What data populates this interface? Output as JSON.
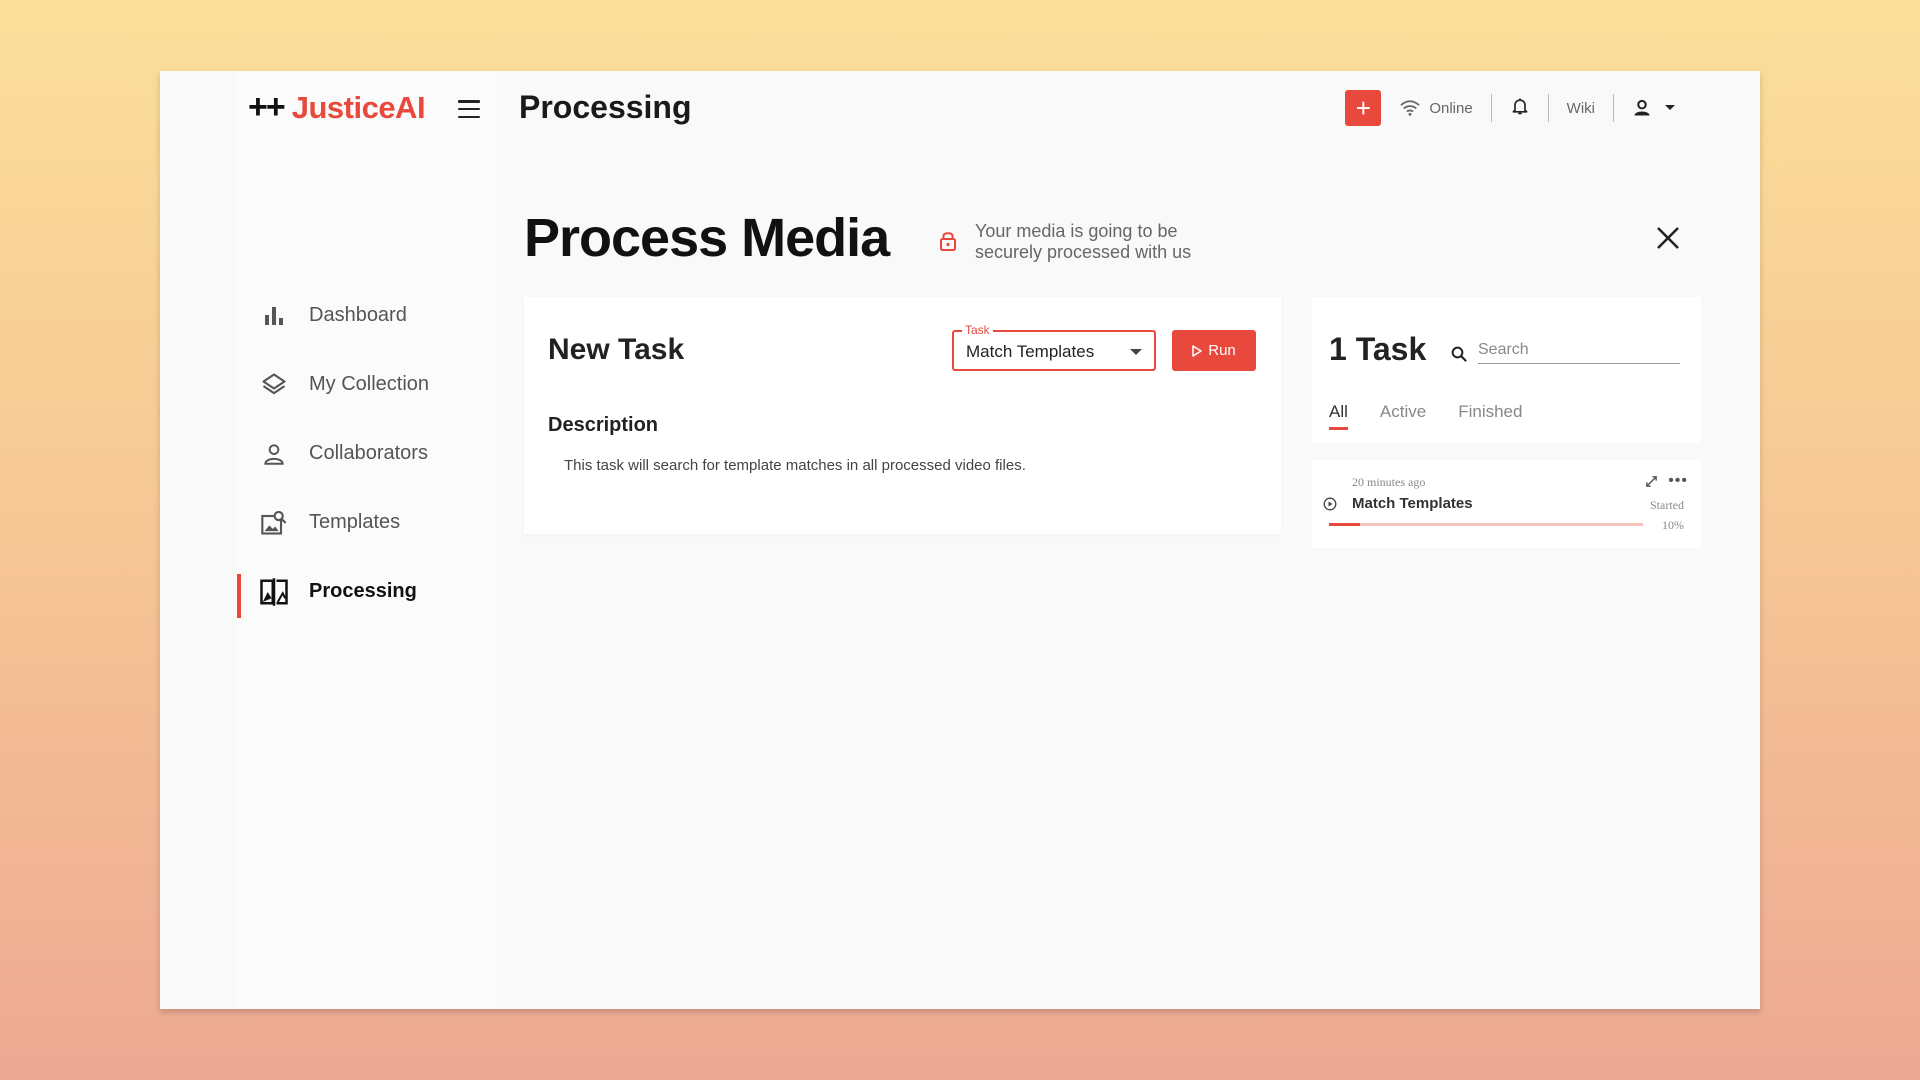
{
  "app": {
    "brand_symbol": "++",
    "brand_name": "JusticeAI",
    "page_title": "Processing",
    "accent_color": "#e8493c"
  },
  "header": {
    "add_icon": "plus-icon",
    "status_label": "Online",
    "wiki_label": "Wiki"
  },
  "sidebar": {
    "items": [
      {
        "label": "Dashboard",
        "icon": "bar-chart-icon"
      },
      {
        "label": "My Collection",
        "icon": "layers-icon"
      },
      {
        "label": "Collaborators",
        "icon": "person-icon"
      },
      {
        "label": "Templates",
        "icon": "image-search-icon"
      },
      {
        "label": "Processing",
        "icon": "compare-icon",
        "active": true
      }
    ]
  },
  "main": {
    "heading": "Process Media",
    "secure_note": "Your media is going to be securely processed with us",
    "new_task": {
      "title": "New Task",
      "task_legend": "Task",
      "task_value": "Match Templates",
      "run_label": "Run",
      "description_label": "Description",
      "description_text": "This task will search for template matches in all processed video files."
    }
  },
  "tasks": {
    "count_label": "1 Task",
    "search_placeholder": "Search",
    "tabs": [
      "All",
      "Active",
      "Finished"
    ],
    "active_tab": "All",
    "items": [
      {
        "time": "20 minutes ago",
        "name": "Match Templates",
        "status": "Started",
        "progress_label": "10%",
        "progress": 0.1
      }
    ]
  }
}
